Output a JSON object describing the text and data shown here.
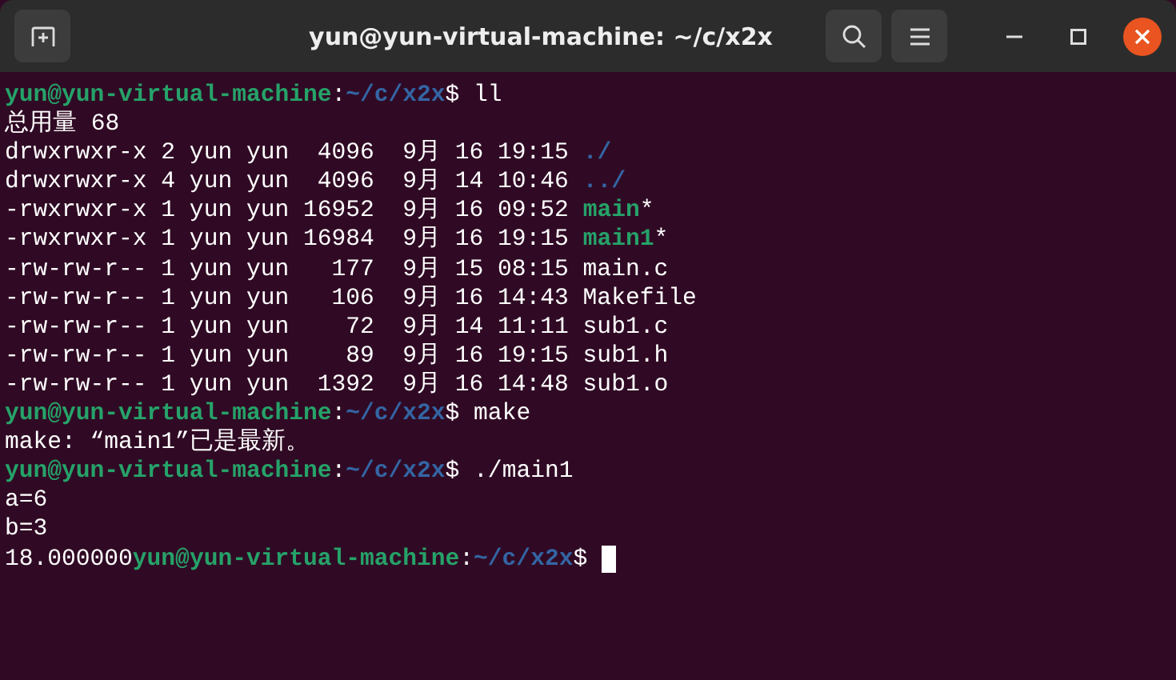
{
  "window": {
    "title": "yun@yun-virtual-machine: ~/c/x2x"
  },
  "terminal": {
    "lines": [
      {
        "segments": [
          {
            "kind": "user",
            "text": "yun@yun-virtual-machine"
          },
          {
            "kind": "plain",
            "text": ":"
          },
          {
            "kind": "path",
            "text": "~/c/x2x"
          },
          {
            "kind": "plain",
            "text": "$ ll"
          }
        ]
      },
      {
        "segments": [
          {
            "kind": "plain",
            "text": "总用量 68"
          }
        ]
      },
      {
        "segments": [
          {
            "kind": "plain",
            "text": "drwxrwxr-x 2 yun yun  4096  9月 16 19:15 "
          },
          {
            "kind": "dir",
            "text": "./"
          }
        ]
      },
      {
        "segments": [
          {
            "kind": "plain",
            "text": "drwxrwxr-x 4 yun yun  4096  9月 14 10:46 "
          },
          {
            "kind": "dir",
            "text": "../"
          }
        ]
      },
      {
        "segments": [
          {
            "kind": "plain",
            "text": "-rwxrwxr-x 1 yun yun 16952  9月 16 09:52 "
          },
          {
            "kind": "exec",
            "text": "main"
          },
          {
            "kind": "plain",
            "text": "*"
          }
        ]
      },
      {
        "segments": [
          {
            "kind": "plain",
            "text": "-rwxrwxr-x 1 yun yun 16984  9月 16 19:15 "
          },
          {
            "kind": "exec",
            "text": "main1"
          },
          {
            "kind": "plain",
            "text": "*"
          }
        ]
      },
      {
        "segments": [
          {
            "kind": "plain",
            "text": "-rw-rw-r-- 1 yun yun   177  9月 15 08:15 main.c"
          }
        ]
      },
      {
        "segments": [
          {
            "kind": "plain",
            "text": "-rw-rw-r-- 1 yun yun   106  9月 16 14:43 Makefile"
          }
        ]
      },
      {
        "segments": [
          {
            "kind": "plain",
            "text": "-rw-rw-r-- 1 yun yun    72  9月 14 11:11 sub1.c"
          }
        ]
      },
      {
        "segments": [
          {
            "kind": "plain",
            "text": "-rw-rw-r-- 1 yun yun    89  9月 16 19:15 sub1.h"
          }
        ]
      },
      {
        "segments": [
          {
            "kind": "plain",
            "text": "-rw-rw-r-- 1 yun yun  1392  9月 16 14:48 sub1.o"
          }
        ]
      },
      {
        "segments": [
          {
            "kind": "user",
            "text": "yun@yun-virtual-machine"
          },
          {
            "kind": "plain",
            "text": ":"
          },
          {
            "kind": "path",
            "text": "~/c/x2x"
          },
          {
            "kind": "plain",
            "text": "$ make"
          }
        ]
      },
      {
        "segments": [
          {
            "kind": "plain",
            "text": "make: “main1”已是最新。"
          }
        ]
      },
      {
        "segments": [
          {
            "kind": "user",
            "text": "yun@yun-virtual-machine"
          },
          {
            "kind": "plain",
            "text": ":"
          },
          {
            "kind": "path",
            "text": "~/c/x2x"
          },
          {
            "kind": "plain",
            "text": "$ ./main1"
          }
        ]
      },
      {
        "segments": [
          {
            "kind": "plain",
            "text": "a=6"
          }
        ]
      },
      {
        "segments": [
          {
            "kind": "plain",
            "text": "b=3"
          }
        ]
      },
      {
        "segments": [
          {
            "kind": "plain",
            "text": "18.000000"
          },
          {
            "kind": "user",
            "text": "yun@yun-virtual-machine"
          },
          {
            "kind": "plain",
            "text": ":"
          },
          {
            "kind": "path",
            "text": "~/c/x2x"
          },
          {
            "kind": "plain",
            "text": "$ "
          }
        ],
        "cursor": true
      }
    ]
  }
}
